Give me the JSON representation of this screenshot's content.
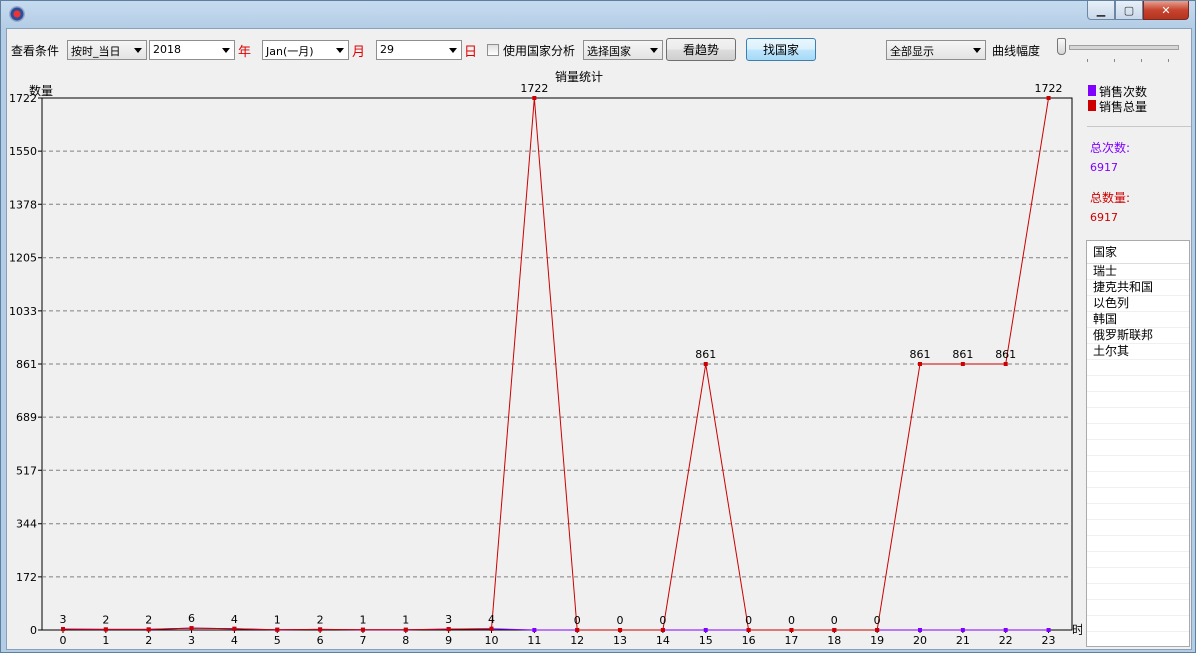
{
  "toolbar": {
    "view_condition_label": "查看条件",
    "mode_combo": "按时_当日",
    "year_combo": "2018",
    "year_label": "年",
    "month_combo": "Jan(一月)",
    "month_label": "月",
    "day_combo": "29",
    "day_label": "日",
    "country_analysis_checkbox_label": "使用国家分析",
    "country_analysis_checked": false,
    "country_select_combo": "选择国家",
    "trend_button": "看趋势",
    "find_country_button": "找国家",
    "display_combo": "全部显示",
    "curve_amplitude_label": "曲线幅度",
    "curve_amplitude_level": 0
  },
  "chart_data": {
    "type": "line",
    "title": "销量统计",
    "ylabel": "数量",
    "xlabel": "时",
    "ylim": [
      0,
      1722
    ],
    "yticks": [
      0,
      172,
      344,
      517,
      689,
      861,
      1033,
      1205,
      1378,
      1550,
      1722
    ],
    "categories": [
      "0",
      "1",
      "2",
      "3",
      "4",
      "5",
      "6",
      "7",
      "8",
      "9",
      "10",
      "11",
      "12",
      "13",
      "14",
      "15",
      "16",
      "17",
      "18",
      "19",
      "20",
      "21",
      "22",
      "23"
    ],
    "grid": true,
    "series": [
      {
        "name": "销售次数",
        "color": "#8000ff",
        "values": [
          3,
          2,
          2,
          6,
          4,
          1,
          2,
          1,
          1,
          3,
          4,
          0,
          0,
          0,
          0,
          0,
          0,
          0,
          0,
          0,
          0,
          0,
          0,
          0
        ],
        "labeled": true
      },
      {
        "name": "销售总量",
        "color": "#cc0000",
        "values": [
          3,
          2,
          2,
          6,
          4,
          1,
          2,
          1,
          1,
          3,
          4,
          1722,
          0,
          0,
          0,
          861,
          0,
          0,
          0,
          0,
          861,
          861,
          861,
          1722
        ],
        "labeled": true
      }
    ]
  },
  "stats": {
    "total_times_label": "总次数:",
    "total_times_value": "6917",
    "total_qty_label": "总数量:",
    "total_qty_value": "6917"
  },
  "country_list": {
    "header": "国家",
    "items": [
      "瑞士",
      "捷克共和国",
      "以色列",
      "韩国",
      "俄罗斯联邦",
      "土尔其"
    ]
  }
}
